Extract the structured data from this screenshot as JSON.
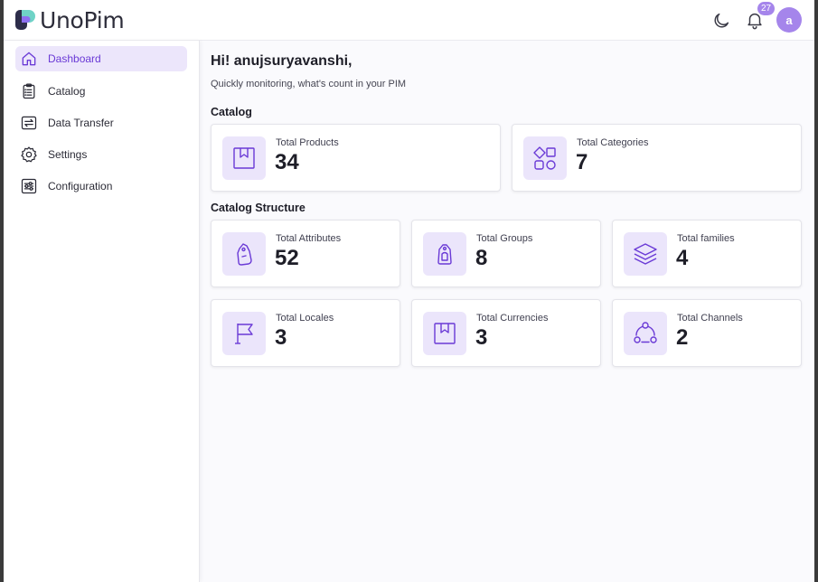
{
  "header": {
    "logo_text": "UnoPim",
    "notification_count": "27",
    "avatar_initial": "a"
  },
  "sidebar": {
    "items": [
      {
        "label": "Dashboard",
        "icon": "home-icon",
        "active": true
      },
      {
        "label": "Catalog",
        "icon": "clipboard-icon"
      },
      {
        "label": "Data Transfer",
        "icon": "transfer-icon"
      },
      {
        "label": "Settings",
        "icon": "gear-icon"
      },
      {
        "label": "Configuration",
        "icon": "sliders-icon"
      }
    ]
  },
  "main": {
    "greeting": "Hi! anujsuryavanshi,",
    "subtitle": "Quickly monitoring, what's count in your PIM",
    "catalog_section": {
      "title": "Catalog",
      "cards": [
        {
          "label": "Total Products",
          "value": "34",
          "icon": "bookmark-box-icon"
        },
        {
          "label": "Total Categories",
          "value": "7",
          "icon": "shapes-icon"
        }
      ]
    },
    "structure_section": {
      "title": "Catalog Structure",
      "cards": [
        {
          "label": "Total Attributes",
          "value": "52",
          "icon": "tag-icon"
        },
        {
          "label": "Total Groups",
          "value": "8",
          "icon": "tag-group-icon"
        },
        {
          "label": "Total families",
          "value": "4",
          "icon": "layers-icon"
        },
        {
          "label": "Total Locales",
          "value": "3",
          "icon": "flag-icon"
        },
        {
          "label": "Total Currencies",
          "value": "3",
          "icon": "bookmark-box-icon"
        },
        {
          "label": "Total Channels",
          "value": "2",
          "icon": "channels-icon"
        }
      ]
    }
  },
  "colors": {
    "accent": "#6a3ad6",
    "accent_light": "#ece6fb",
    "badge": "#a585eb"
  }
}
